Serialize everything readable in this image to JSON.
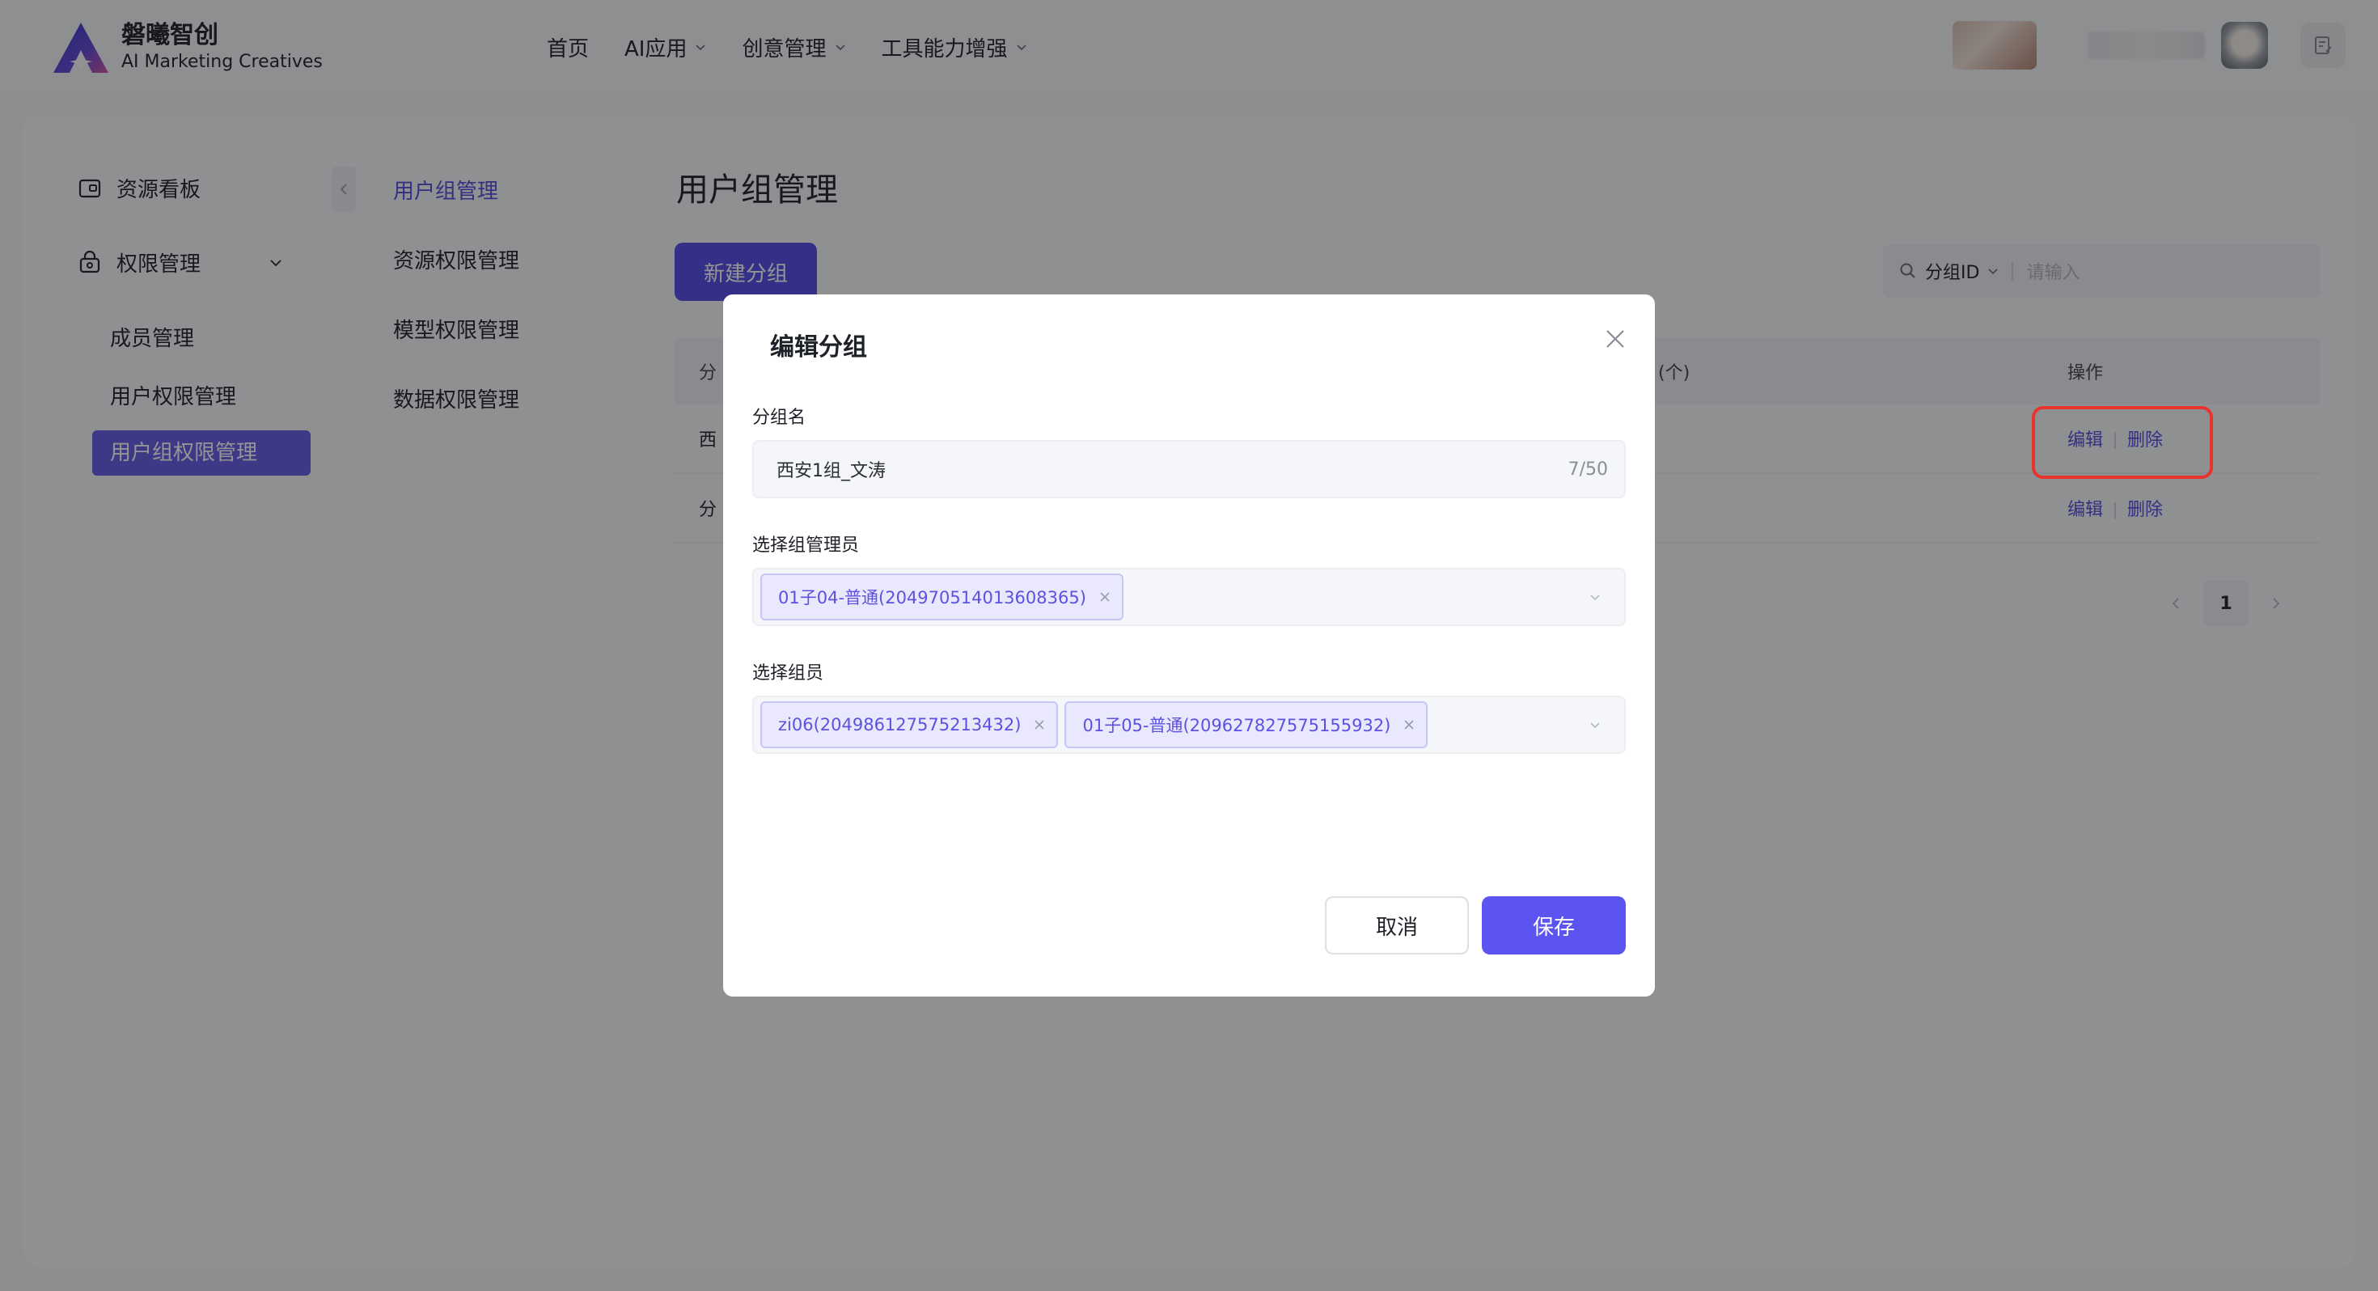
{
  "app": {
    "name_cn": "磐曦智创",
    "name_en": "AI Marketing Creatives",
    "brand_color": "#5c54e8"
  },
  "top_nav": [
    {
      "label": "首页",
      "has_dropdown": false
    },
    {
      "label": "AI应用",
      "has_dropdown": true
    },
    {
      "label": "创意管理",
      "has_dropdown": true
    },
    {
      "label": "工具能力增强",
      "has_dropdown": true
    }
  ],
  "sidebar": {
    "items": [
      {
        "label": "资源看板",
        "icon": "dashboard-icon"
      },
      {
        "label": "权限管理",
        "icon": "lock-icon",
        "expanded": true
      }
    ],
    "sub_items": [
      {
        "label": "成员管理",
        "active": false
      },
      {
        "label": "用户权限管理",
        "active": false
      },
      {
        "label": "用户组权限管理",
        "active": true
      }
    ]
  },
  "secondary_nav": [
    {
      "label": "用户组管理",
      "active": true
    },
    {
      "label": "资源权限管理",
      "active": false
    },
    {
      "label": "模型权限管理",
      "active": false
    },
    {
      "label": "数据权限管理",
      "active": false
    }
  ],
  "page": {
    "title": "用户组管理",
    "new_button": "新建分组",
    "search": {
      "field": "分组ID",
      "placeholder": "请输入"
    }
  },
  "table": {
    "headers": {
      "first": "分",
      "count": "(个)",
      "actions": "操作"
    },
    "rows": [
      {
        "first": "西",
        "edit": "编辑",
        "delete": "删除"
      },
      {
        "first": "分",
        "edit": "编辑",
        "delete": "删除"
      }
    ]
  },
  "pagination": {
    "current": "1"
  },
  "modal": {
    "title": "编辑分组",
    "group_name_label": "分组名",
    "group_name_value": "西安1组_文涛",
    "group_name_count": "7/50",
    "admin_label": "选择组管理员",
    "admins": [
      "01子04-普通(204970514013608365)"
    ],
    "members_label": "选择组员",
    "members": [
      "zi06(204986127575213432)",
      "01子05-普通(209627827575155932)"
    ],
    "cancel": "取消",
    "save": "保存"
  }
}
